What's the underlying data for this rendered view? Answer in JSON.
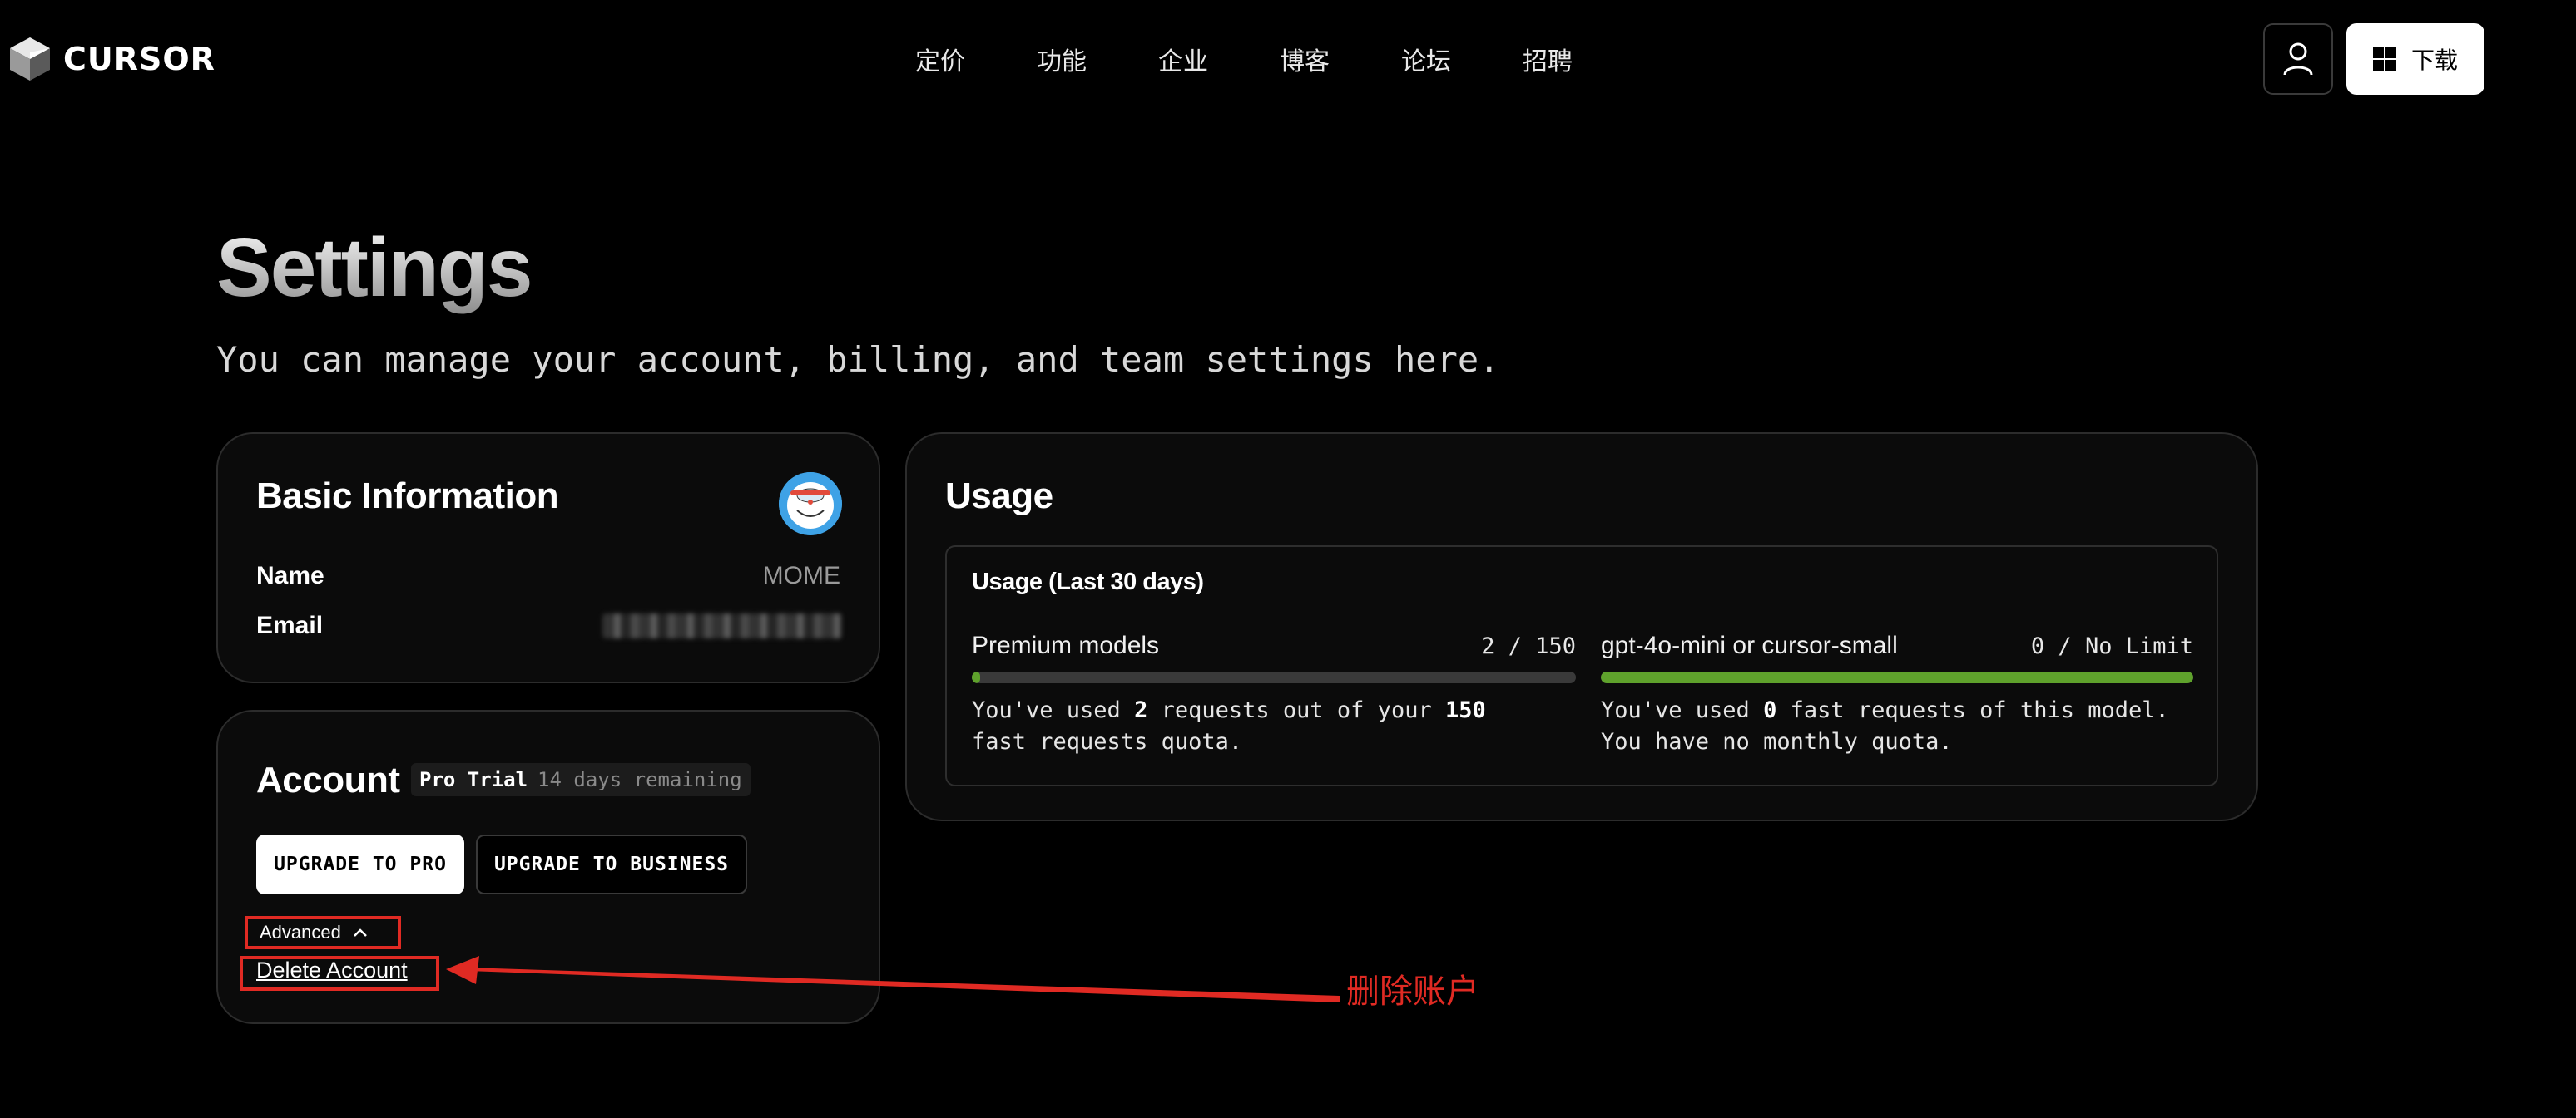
{
  "header": {
    "logo_text": "CURSOR",
    "nav": [
      "定价",
      "功能",
      "企业",
      "博客",
      "论坛",
      "招聘"
    ],
    "user_icon": "user-icon",
    "download_label": "下载",
    "download_icon": "windows-icon"
  },
  "page": {
    "title": "Settings",
    "subtitle": "You can manage your account, billing, and team settings here."
  },
  "basic_info": {
    "title": "Basic Information",
    "name_label": "Name",
    "name_value": "MOME",
    "email_label": "Email",
    "email_value": ""
  },
  "account": {
    "title": "Account",
    "plan": "Pro Trial",
    "remaining": "14 days remaining",
    "upgrade_pro": "UPGRADE TO PRO",
    "upgrade_business": "UPGRADE TO BUSINESS",
    "advanced_label": "Advanced",
    "delete_label": "Delete Account"
  },
  "usage": {
    "title": "Usage",
    "period_heading": "Usage (Last 30 days)",
    "models": [
      {
        "name": "Premium models",
        "count": "2 / 150",
        "used": 2,
        "quota": 150,
        "desc_prefix": "You've used ",
        "desc_num1": "2",
        "desc_mid": " requests out of your ",
        "desc_num2": "150",
        "desc_suffix": "fast requests quota."
      },
      {
        "name": "gpt-4o-mini or cursor-small",
        "count": "0 / No Limit",
        "fill_fraction": 1.0,
        "desc_prefix": "You've used ",
        "desc_num1": "0",
        "desc_mid": " fast requests of this model.",
        "desc_suffix": "You have no monthly quota."
      }
    ]
  },
  "annotation": {
    "text": "删除账户",
    "color": "#e02a23"
  },
  "colors": {
    "background": "#000000",
    "card": "#0b0b0b",
    "progress": "#5fa22c",
    "annotation": "#e02a23"
  }
}
